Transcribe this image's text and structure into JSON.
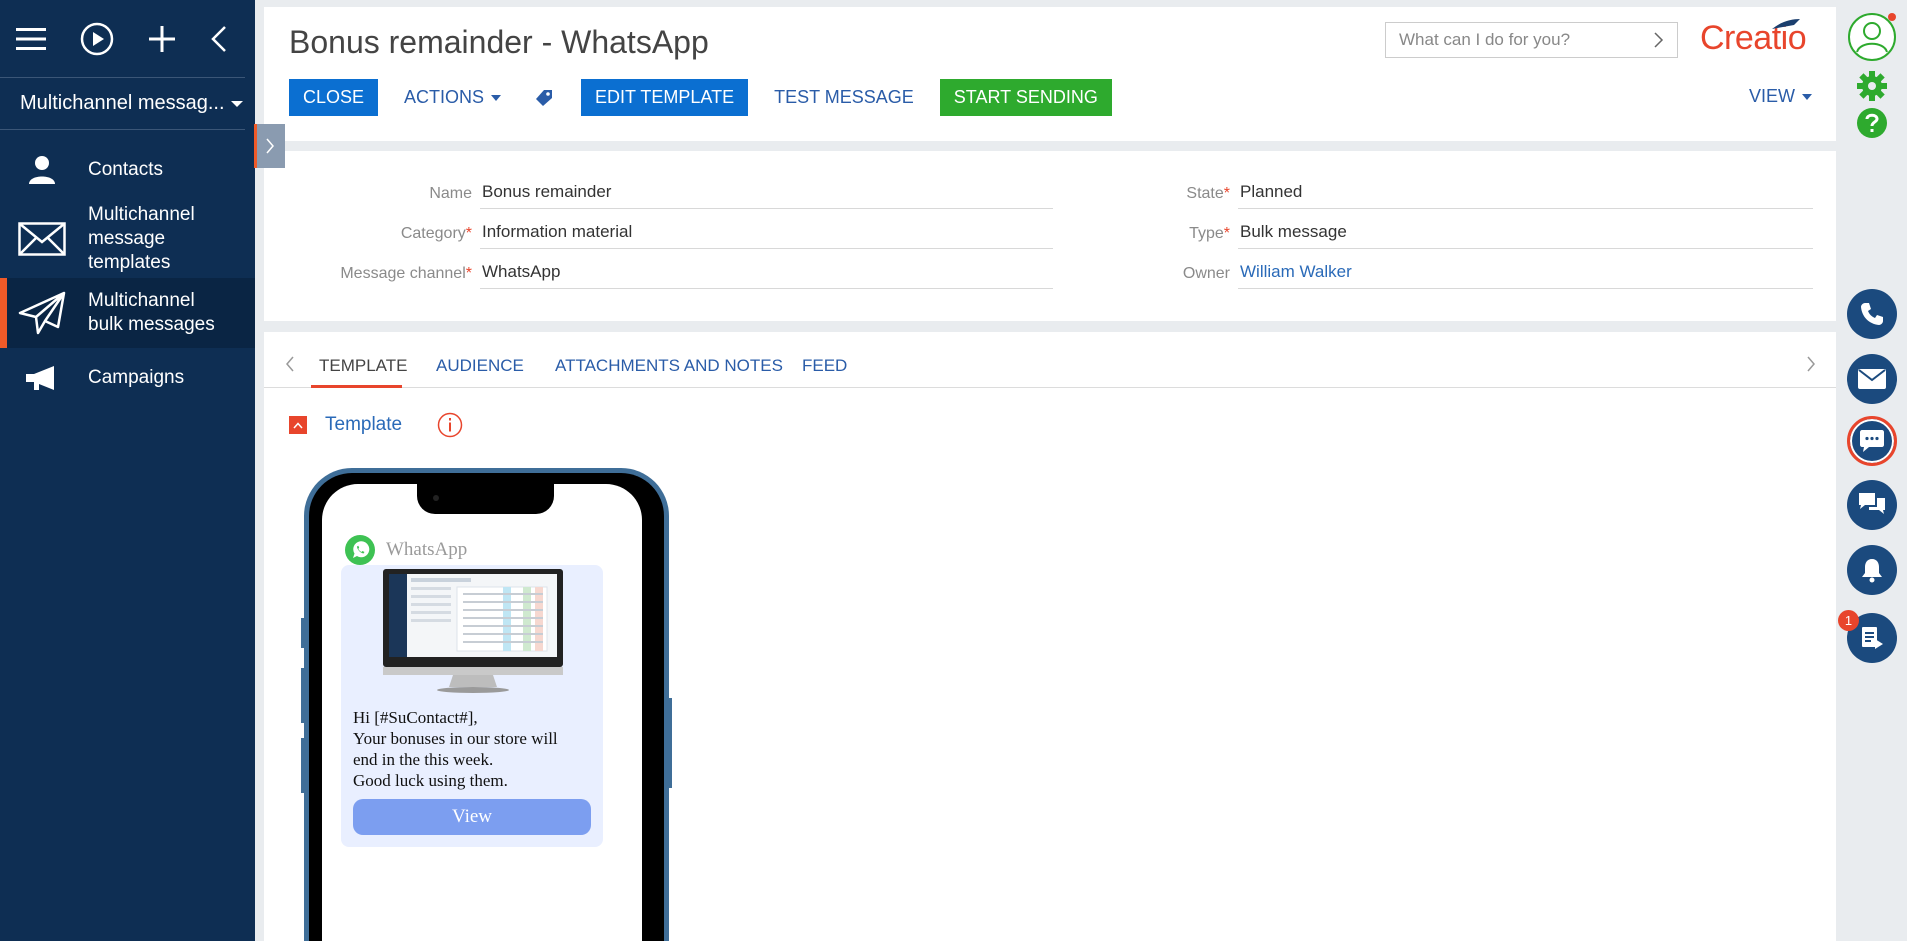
{
  "sidebar": {
    "workplace": "Multichannel messag...",
    "items": [
      {
        "label": "Contacts",
        "icon": "person-icon"
      },
      {
        "label": "Multichannel\nmessage\ntemplates",
        "icon": "envelope-icon"
      },
      {
        "label": "Multichannel\nbulk messages",
        "icon": "paper-plane-icon"
      },
      {
        "label": "Campaigns",
        "icon": "megaphone-icon"
      }
    ]
  },
  "header": {
    "title": "Bonus remainder - WhatsApp",
    "search_placeholder": "What can I do for you?",
    "logo": "Creatio",
    "buttons": {
      "close": "CLOSE",
      "actions": "ACTIONS",
      "edit_template": "EDIT TEMPLATE",
      "test_message": "TEST MESSAGE",
      "start_sending": "START SENDING",
      "view": "VIEW"
    }
  },
  "fields": {
    "name": {
      "label": "Name",
      "value": "Bonus remainder"
    },
    "category": {
      "label": "Category",
      "value": "Information material"
    },
    "channel": {
      "label": "Message channel",
      "value": "WhatsApp"
    },
    "state": {
      "label": "State",
      "value": "Planned"
    },
    "type": {
      "label": "Type",
      "value": "Bulk message"
    },
    "owner": {
      "label": "Owner",
      "value": "William Walker"
    },
    "required_mark": "*"
  },
  "tabs": [
    "TEMPLATE",
    "AUDIENCE",
    "ATTACHMENTS AND NOTES",
    "FEED"
  ],
  "template_group": {
    "title": "Template"
  },
  "preview": {
    "app_name": "WhatsApp",
    "lines": [
      "Hi [#SuContact#],",
      "Your bonuses in our store will",
      "end in the this week.",
      "Good luck using them."
    ],
    "button": "View"
  },
  "rail": {
    "notification_count": "1"
  },
  "colors": {
    "sidebar": "#0e2e53",
    "accent": "#e8452c",
    "primary": "#0b6fd1",
    "start": "#2eaa2e",
    "link": "#2a5ca8"
  }
}
